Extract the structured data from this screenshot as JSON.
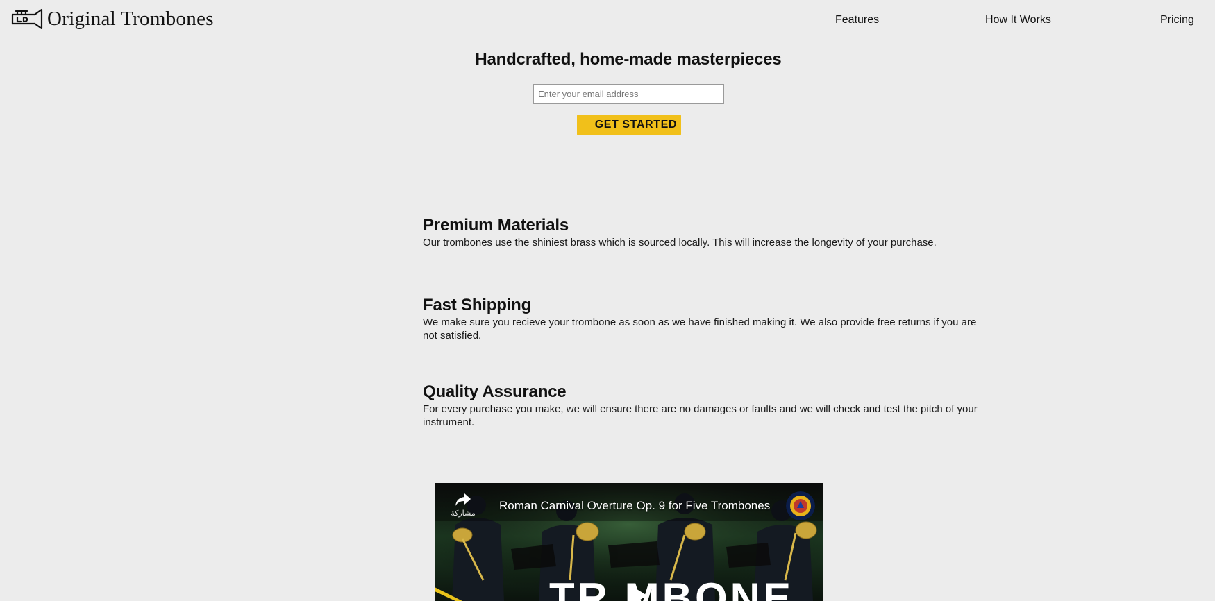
{
  "header": {
    "brand": "Original Trombones",
    "logo_icon": "trombone-logo-icon",
    "nav": [
      {
        "label": "Features"
      },
      {
        "label": "How It Works"
      },
      {
        "label": "Pricing"
      }
    ]
  },
  "hero": {
    "title": "Handcrafted, home-made masterpieces",
    "email_placeholder": "Enter your email address",
    "cta_label": "GET STARTED",
    "cta_color": "#f1c01a"
  },
  "features": [
    {
      "title": "Premium Materials",
      "text": "Our trombones use the shiniest brass which is sourced locally. This will increase the longevity of your purchase."
    },
    {
      "title": "Fast Shipping",
      "text": "We make sure you recieve your trombone as soon as we have finished making it. We also provide free returns if you are not satisfied."
    },
    {
      "title": "Quality Assurance",
      "text": "For every purchase you make, we will ensure there are no damages or faults and we will check and test the pitch of your instrument."
    }
  ],
  "video": {
    "title": "Roman Carnival Overture Op. 9 for Five Trombones",
    "share_label": "مشاركة",
    "share_icon": "share-arrow-icon",
    "play_icon": "play-icon",
    "overlay_text": "TR  MBONE"
  }
}
